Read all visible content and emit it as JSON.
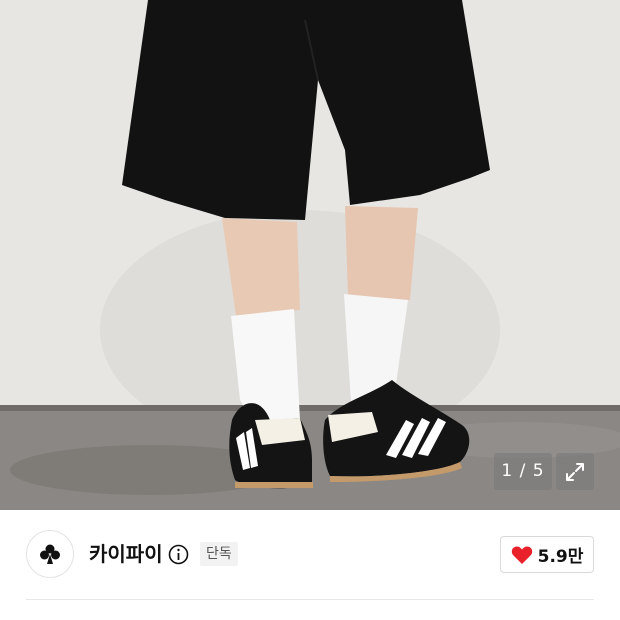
{
  "gallery": {
    "image_icon": "product-photo",
    "counter": "1 / 5",
    "expand_icon": "expand-arrows-icon"
  },
  "brand": {
    "logo_icon": "club-logo-icon",
    "name": "카이파이",
    "info_icon": "info-icon",
    "badge": "단독"
  },
  "like": {
    "icon": "heart-icon",
    "count": "5.9만",
    "color": "#e8212b"
  }
}
